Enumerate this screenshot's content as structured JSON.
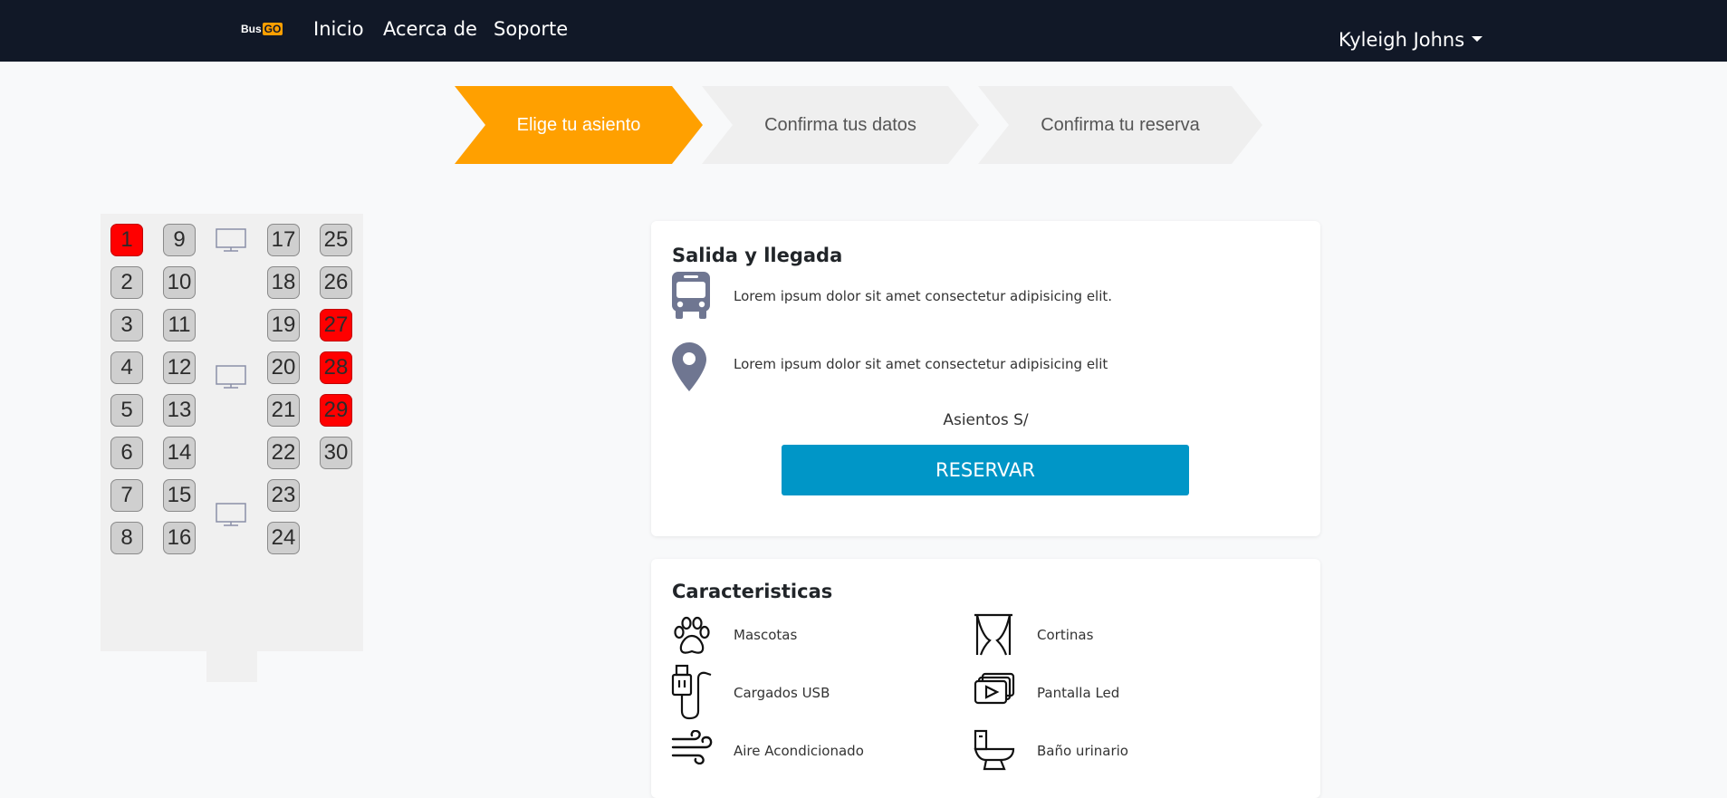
{
  "navbar": {
    "logo_bus": "Bus",
    "logo_go": "GO",
    "links": [
      "Inicio",
      "Acerca de",
      "Soporte"
    ],
    "user_name": "Kyleigh Johns",
    "bg_color": "#111827"
  },
  "stepper": {
    "steps": [
      "Elige tu asiento",
      "Confirma tus datos",
      "Confirma tu reserva"
    ],
    "active_index": 0,
    "active_color": "#ffa000"
  },
  "seat_map": {
    "columns": [
      [
        1,
        2,
        3,
        4,
        5,
        6,
        7,
        8
      ],
      [
        9,
        10,
        11,
        12,
        13,
        14,
        15,
        16
      ],
      [
        17,
        18,
        19,
        20,
        21,
        22,
        23,
        24
      ],
      [
        25,
        26,
        27,
        28,
        29,
        30
      ]
    ],
    "taken": [
      1,
      27,
      28,
      29
    ],
    "taken_color": "#ff0000",
    "available_color": "#cfcfcf",
    "tv_icon": "monitor-icon"
  },
  "trip_card": {
    "title": "Salida y llegada",
    "departure_text": "Lorem ipsum dolor sit amet consectetur adipisicing elit.",
    "arrival_text": "Lorem ipsum dolor sit amet consectetur adipisicing elit",
    "departure_icon": "bus-icon",
    "arrival_icon": "map-pin-icon",
    "price_label": "Asientos S/",
    "reserve_button": "RESERVAR",
    "button_color": "#0096c7"
  },
  "features_card": {
    "title": "Caracteristicas",
    "items": [
      {
        "label": "Mascotas",
        "icon": "paw-icon"
      },
      {
        "label": "Cortinas",
        "icon": "curtains-icon"
      },
      {
        "label": "Cargados USB",
        "icon": "usb-icon"
      },
      {
        "label": "Pantalla Led",
        "icon": "screen-play-icon"
      },
      {
        "label": "Aire Acondicionado",
        "icon": "wind-icon"
      },
      {
        "label": "Baño urinario",
        "icon": "toilet-icon"
      }
    ]
  }
}
